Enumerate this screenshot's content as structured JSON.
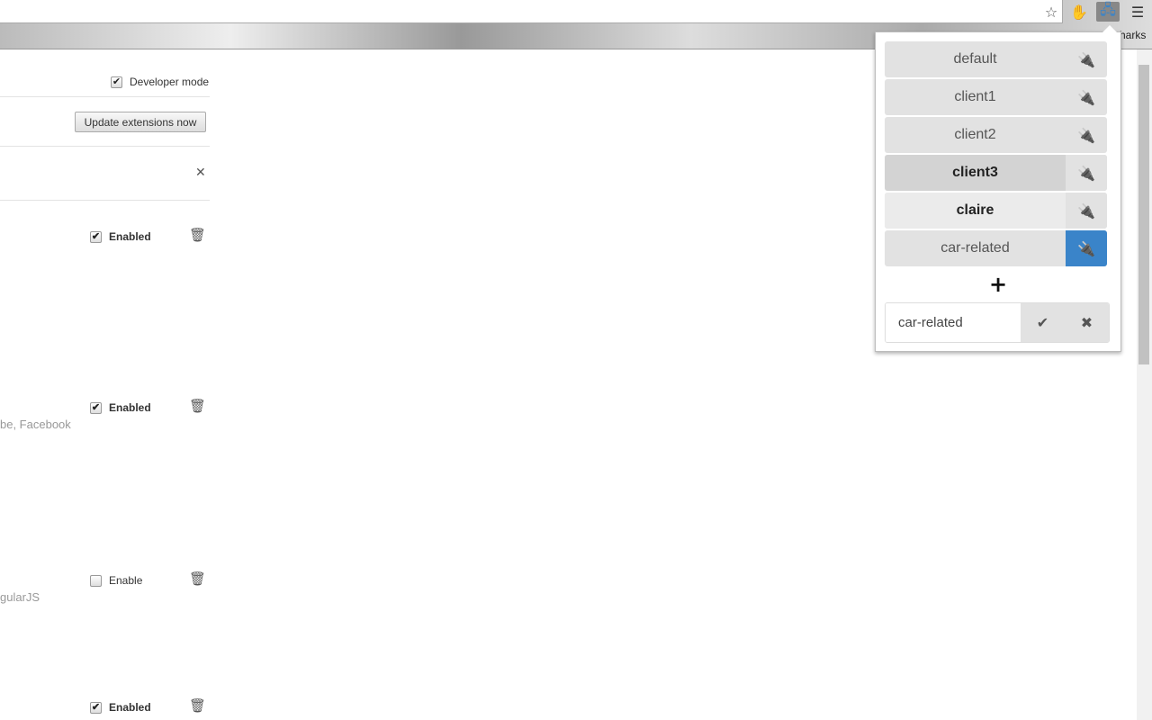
{
  "toolbar": {
    "star_icon": "star-icon",
    "blocker_icon": "hand-stop-icon",
    "ext_icon": "network-computers-icon",
    "menu_icon": "hamburger-icon",
    "bookmarks_partial": "harks"
  },
  "extensions_page": {
    "developer_mode_label": "Developer mode",
    "developer_mode_checked": true,
    "update_button": "Update extensions now",
    "items": [
      {
        "status_label": "Enabled",
        "checked": true,
        "desc": ""
      },
      {
        "status_label": "Enabled",
        "checked": true,
        "desc": "be, Facebook"
      },
      {
        "status_label": "Enable",
        "checked": false,
        "desc": "gularJS"
      },
      {
        "status_label": "Enabled",
        "checked": true,
        "desc": ""
      }
    ]
  },
  "popup": {
    "profiles": [
      {
        "name": "default"
      },
      {
        "name": "client1"
      },
      {
        "name": "client2"
      },
      {
        "name": "client3",
        "state": "hovered"
      },
      {
        "name": "claire",
        "state": "current"
      },
      {
        "name": "car-related",
        "state": "active"
      }
    ],
    "add_symbol": "+",
    "edit_value": "car-related",
    "accent": "#3a84c9"
  }
}
